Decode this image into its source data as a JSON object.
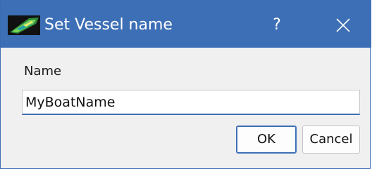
{
  "window": {
    "title": "Set Vessel name",
    "help_label": "?",
    "app_icon": "boat-app-icon",
    "close_icon": "close-icon"
  },
  "form": {
    "name_label": "Name",
    "name_value": "MyBoatName"
  },
  "buttons": {
    "ok_label": "OK",
    "cancel_label": "Cancel"
  },
  "colors": {
    "titlebar": "#3d6fb6",
    "title_text": "#ffffff",
    "background": "#f0f0f0",
    "accent": "#3d6fb6"
  }
}
